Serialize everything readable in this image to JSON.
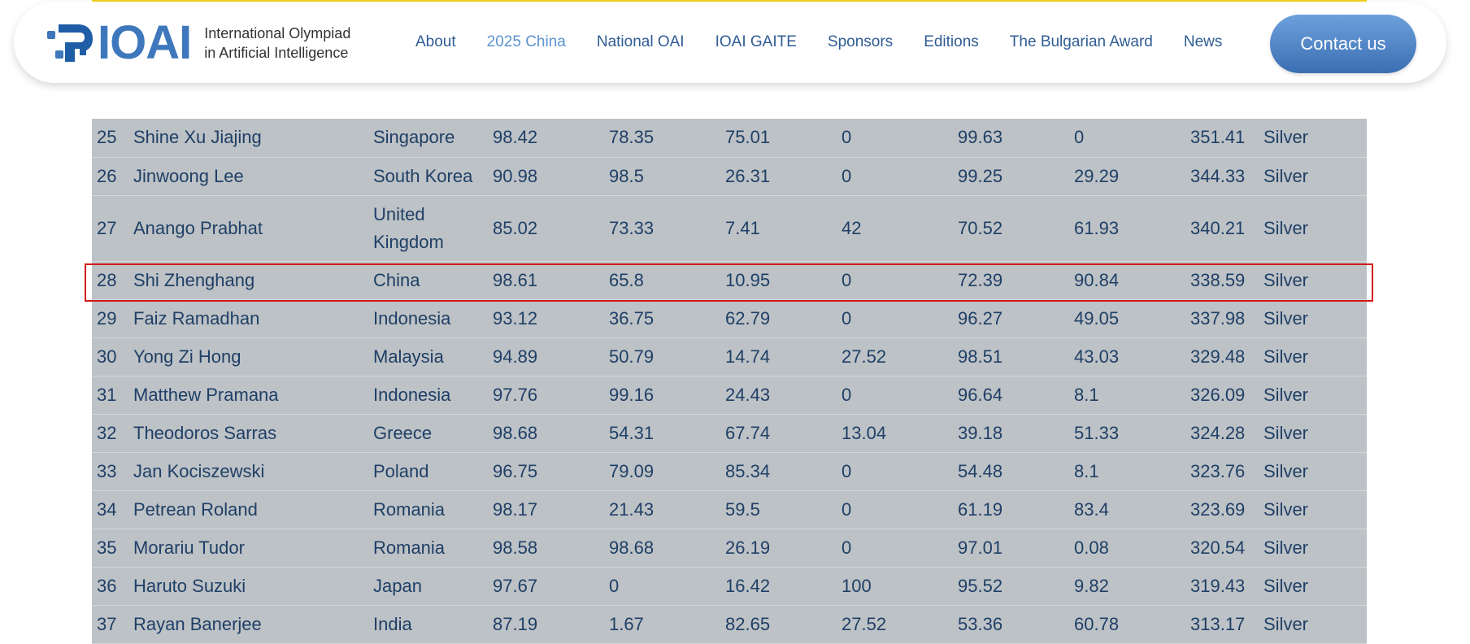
{
  "header": {
    "logo_text": "IOAI",
    "logo_line1": "International Olympiad",
    "logo_line2": "in Artificial Intelligence",
    "nav": [
      {
        "label": "About",
        "active": false
      },
      {
        "label": "2025 China",
        "active": true
      },
      {
        "label": "National OAI",
        "active": false
      },
      {
        "label": "IOAI GAITE",
        "active": false
      },
      {
        "label": "Sponsors",
        "active": false
      },
      {
        "label": "Editions",
        "active": false
      },
      {
        "label": "The Bulgarian Award",
        "active": false
      },
      {
        "label": "News",
        "active": false
      }
    ],
    "contact_label": "Contact us"
  },
  "colors": {
    "brand_blue": "#3e77bc",
    "accent_yellow": "#f1d31b",
    "table_bg": "#bdc2c6",
    "highlight": "#d11a1a"
  },
  "results": {
    "highlighted_rank": "28",
    "rows": [
      [
        "25",
        "Shine Xu Jiajing",
        "Singapore",
        "98.42",
        "78.35",
        "75.01",
        "0",
        "99.63",
        "0",
        "351.41",
        "Silver"
      ],
      [
        "26",
        "Jinwoong Lee",
        "South Korea",
        "90.98",
        "98.5",
        "26.31",
        "0",
        "99.25",
        "29.29",
        "344.33",
        "Silver"
      ],
      [
        "27",
        "Anango Prabhat",
        "United Kingdom",
        "85.02",
        "73.33",
        "7.41",
        "42",
        "70.52",
        "61.93",
        "340.21",
        "Silver"
      ],
      [
        "28",
        "Shi Zhenghang",
        "China",
        "98.61",
        "65.8",
        "10.95",
        "0",
        "72.39",
        "90.84",
        "338.59",
        "Silver"
      ],
      [
        "29",
        "Faiz Ramadhan",
        "Indonesia",
        "93.12",
        "36.75",
        "62.79",
        "0",
        "96.27",
        "49.05",
        "337.98",
        "Silver"
      ],
      [
        "30",
        "Yong Zi Hong",
        "Malaysia",
        "94.89",
        "50.79",
        "14.74",
        "27.52",
        "98.51",
        "43.03",
        "329.48",
        "Silver"
      ],
      [
        "31",
        "Matthew Pramana",
        "Indonesia",
        "97.76",
        "99.16",
        "24.43",
        "0",
        "96.64",
        "8.1",
        "326.09",
        "Silver"
      ],
      [
        "32",
        "Theodoros Sarras",
        "Greece",
        "98.68",
        "54.31",
        "67.74",
        "13.04",
        "39.18",
        "51.33",
        "324.28",
        "Silver"
      ],
      [
        "33",
        "Jan Kociszewski",
        "Poland",
        "96.75",
        "79.09",
        "85.34",
        "0",
        "54.48",
        "8.1",
        "323.76",
        "Silver"
      ],
      [
        "34",
        "Petrean Roland",
        "Romania",
        "98.17",
        "21.43",
        "59.5",
        "0",
        "61.19",
        "83.4",
        "323.69",
        "Silver"
      ],
      [
        "35",
        "Morariu Tudor",
        "Romania",
        "98.58",
        "98.68",
        "26.19",
        "0",
        "97.01",
        "0.08",
        "320.54",
        "Silver"
      ],
      [
        "36",
        "Haruto Suzuki",
        "Japan",
        "97.67",
        "0",
        "16.42",
        "100",
        "95.52",
        "9.82",
        "319.43",
        "Silver"
      ],
      [
        "37",
        "Rayan Banerjee",
        "India",
        "87.19",
        "1.67",
        "82.65",
        "27.52",
        "53.36",
        "60.78",
        "313.17",
        "Silver"
      ]
    ]
  }
}
